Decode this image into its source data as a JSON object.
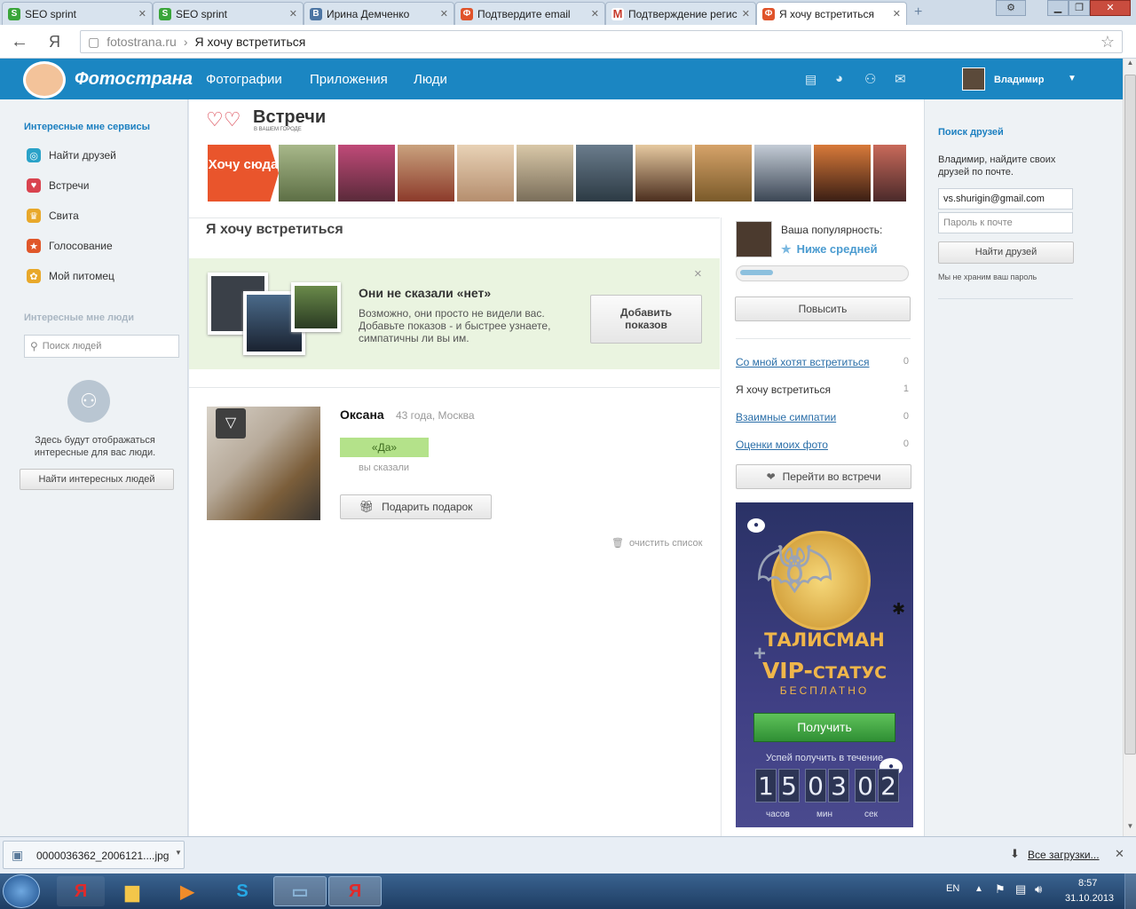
{
  "browser": {
    "tabs": [
      {
        "title": "SEO sprint",
        "icon": "seo-sprint-icon",
        "color": "#3aa53a"
      },
      {
        "title": "SEO sprint",
        "icon": "seo-sprint-icon",
        "color": "#3aa53a"
      },
      {
        "title": "Ирина Демченко",
        "icon": "vk-icon",
        "color": "#4c75a3"
      },
      {
        "title": "Подтвердите email",
        "icon": "fotostrana-icon",
        "color": "#e0532a"
      },
      {
        "title": "Подтверждение регис",
        "icon": "gmail-icon",
        "color": "#c73a2b"
      },
      {
        "title": "Я хочу встретиться",
        "icon": "fotostrana-icon",
        "color": "#e0532a"
      }
    ],
    "url_domain": "fotostrana.ru",
    "url_sep": "›",
    "url_page": "Я хочу встретиться",
    "yandex_letter": "Я"
  },
  "header": {
    "logo": "Фотострана",
    "nav": [
      "Фотографии",
      "Приложения",
      "Люди"
    ],
    "username": "Владимир"
  },
  "left": {
    "services_title": "Интересные мне сервисы",
    "services": [
      {
        "label": "Найти друзей",
        "icon": "find-friends-icon",
        "color": "#2aa2c8"
      },
      {
        "label": "Встречи",
        "icon": "meetings-heart-icon",
        "color": "#d9434f"
      },
      {
        "label": "Свита",
        "icon": "crown-icon",
        "color": "#e8a82a"
      },
      {
        "label": "Голосование",
        "icon": "vote-icon",
        "color": "#e0572a"
      },
      {
        "label": "Мой питомец",
        "icon": "pet-paw-icon",
        "color": "#e8a82a"
      }
    ],
    "people_title": "Интересные мне люди",
    "search_placeholder": "Поиск людей",
    "empty_text": "Здесь будут отображаться интересные для вас люди.",
    "find_button": "Найти интересных людей"
  },
  "meetings": {
    "logo_title": "Встречи",
    "logo_sub": "В ВАШЕМ ГОРОДЕ",
    "want_here": "Хочу сюда",
    "page_title": "Я хочу встретиться",
    "promo": {
      "title": "Они не сказали «нет»",
      "text": "Возможно, они просто не видели вас. Добавьте показов - и быстрее узнаете, симпатичны ли вы им.",
      "button": "Добавить показов",
      "close": "×"
    },
    "person": {
      "name": "Оксана",
      "info": "43 года, Москва",
      "answer": "«Да»",
      "you_said": "вы сказали",
      "gift_button": "Подарить подарок",
      "clear": "очистить список"
    }
  },
  "stats": {
    "popularity_label": "Ваша популярность:",
    "popularity_value": "Ниже средней",
    "popularity_fraction": 0.2,
    "raise_button": "Повысить",
    "rows": [
      {
        "label": "Со мной хотят встретиться",
        "count": "0",
        "link": true
      },
      {
        "label": "Я хочу встретиться",
        "count": "1",
        "link": false
      },
      {
        "label": "Взаимные симпатии",
        "count": "0",
        "link": true
      },
      {
        "label": "Оценки моих фото",
        "count": "0",
        "link": true
      }
    ],
    "go_button": "Перейти во встречи"
  },
  "ad": {
    "line1": "ТАЛИСМАН",
    "plus": "+",
    "vip": "VIP-",
    "status": "СТАТУС",
    "free": "БЕСПЛАТНО",
    "button": "Получить",
    "timer_text": "Успей получить в течение",
    "digits": [
      "1",
      "5",
      "0",
      "3",
      "0",
      "2"
    ],
    "units": [
      "часов",
      "мин",
      "сек"
    ]
  },
  "right": {
    "title": "Поиск друзей",
    "text": "Владимир, найдите своих друзей по почте.",
    "email_value": "vs.shurigin@gmail.com",
    "password_placeholder": "Пароль к почте",
    "find_button": "Найти друзей",
    "note": "Мы не храним ваш пароль"
  },
  "download": {
    "filename": "0000036362_2006121....jpg",
    "all_downloads": "Все загрузки..."
  },
  "taskbar": {
    "lang": "EN",
    "time": "8:57",
    "date": "31.10.2013"
  }
}
